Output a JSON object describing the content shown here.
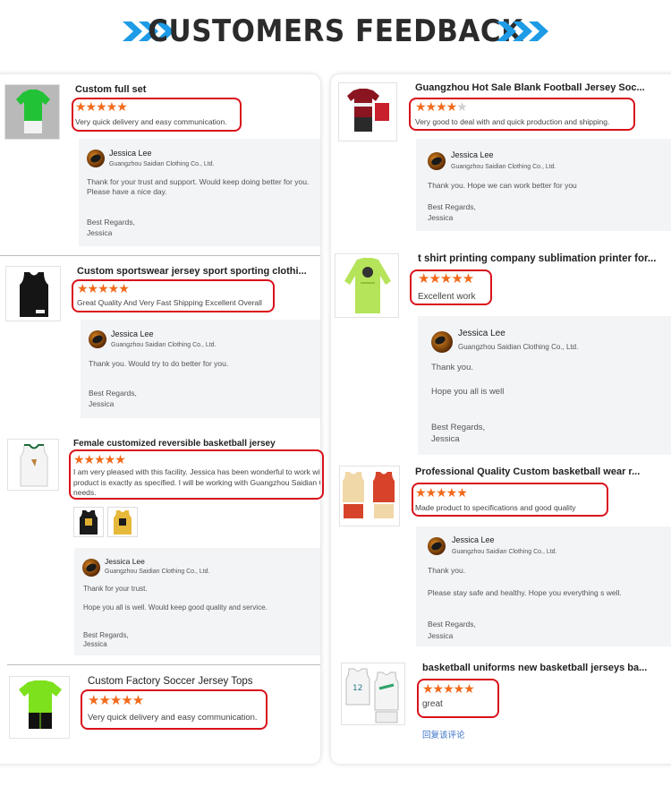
{
  "header": {
    "title": "CUSTOMERS FEEDBACK",
    "accent": "#1e9be6"
  },
  "colors": {
    "star": "#f26a1b",
    "box": "#d9111a",
    "link": "#3a72c8"
  },
  "reply_author": {
    "name": "Jessica Lee",
    "company": "Guangzhou Saidian Clothing Co., Ltd."
  },
  "left": [
    {
      "title": "Custom full set",
      "stars": 5,
      "review": "Very quick delivery and easy communication.",
      "reply": [
        "Thank for your trust and support. Would keep doing better for you.",
        "Please have a nice day.",
        "Best Regards,",
        "Jessica"
      ]
    },
    {
      "title": "Custom sportswear jersey sport sporting clothi...",
      "stars": 5,
      "review": "Great Quality And Very Fast Shipping Excellent Overall",
      "reply": [
        "Thank you. Would try to do better for you.",
        "Best Regards,",
        "Jessica"
      ]
    },
    {
      "title": "Female customized reversible basketball jersey",
      "stars": 5,
      "review_lines": [
        "I am very pleased with this facility. Jessica has been wonderful to work with. T",
        "product is exactly as specified. I will be working with Guangzhou Saidian Cloth",
        "needs."
      ],
      "reply": [
        "Thank  for your trust.",
        "Hope you all is well. Would keep good quality and service.",
        "Best Regards,",
        "Jessica"
      ]
    },
    {
      "title": "Custom Factory Soccer Jersey Tops",
      "stars": 5,
      "review": "Very quick delivery and easy communication."
    }
  ],
  "right": [
    {
      "title": "Guangzhou Hot Sale Blank Football Jersey Soc...",
      "stars": 4,
      "review": "Very good to deal with and quick production and shipping.",
      "reply": [
        "Thank you. Hope we can work better for you",
        "Best Regards,",
        "Jessica"
      ]
    },
    {
      "title": "t shirt printing company sublimation printer for...",
      "stars": 5,
      "review": "Excellent work",
      "reply": [
        "Thank you.",
        "Hope you all is well",
        "Best Regards,",
        "Jessica"
      ]
    },
    {
      "title": "Professional Quality Custom basketball wear r...",
      "stars": 5,
      "review": "Made product to specifications and good quality",
      "reply": [
        "Thank you.",
        "Please stay safe and healthy. Hope you everything s well.",
        "Best Regards,",
        "Jessica"
      ]
    },
    {
      "title": "basketball uniforms new basketball jerseys ba...",
      "stars": 5,
      "review": "great",
      "link": "回复该评论"
    }
  ]
}
